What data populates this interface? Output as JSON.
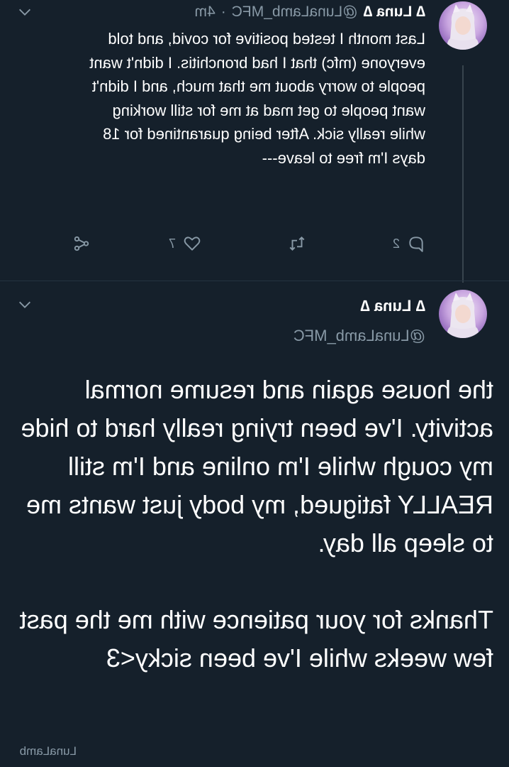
{
  "tweet1": {
    "display_name": "∆ Luna ∆",
    "handle": "@LunaLamb_MFC",
    "separator": "·",
    "time": "4m",
    "text": "Last month I tested positive for covid, and told everyone (mfc) that I had bronchitis. I didn't want people to worry about me that much, and I didn't want people to get mad at me for still working while really sick. After being quarantined for 18 days I'm free to leave---",
    "replies": "2",
    "likes": "7",
    "avatar": "profile-photo"
  },
  "tweet2": {
    "display_name": "∆ Luna ∆",
    "handle": "@LunaLamb_MFC",
    "text_p1": "the house again and resume normal activity. I've been trying really hard to hide my cough while I'm online and I'm still REALLY fatigued, my body just wants me to sleep all day.",
    "text_p2": "Thanks for your patience with me the past few weeks while I've been sicky<3",
    "avatar": "profile-photo"
  },
  "watermark": "LunaLamb",
  "icons": {
    "reply": "reply-icon",
    "retweet": "retweet-icon",
    "like": "heart-icon",
    "share": "share-icon",
    "more": "chevron-down-icon"
  },
  "colors": {
    "background": "#15202b",
    "text_primary": "#ffffff",
    "text_secondary": "#8899a6",
    "thread_line": "#38444d"
  }
}
